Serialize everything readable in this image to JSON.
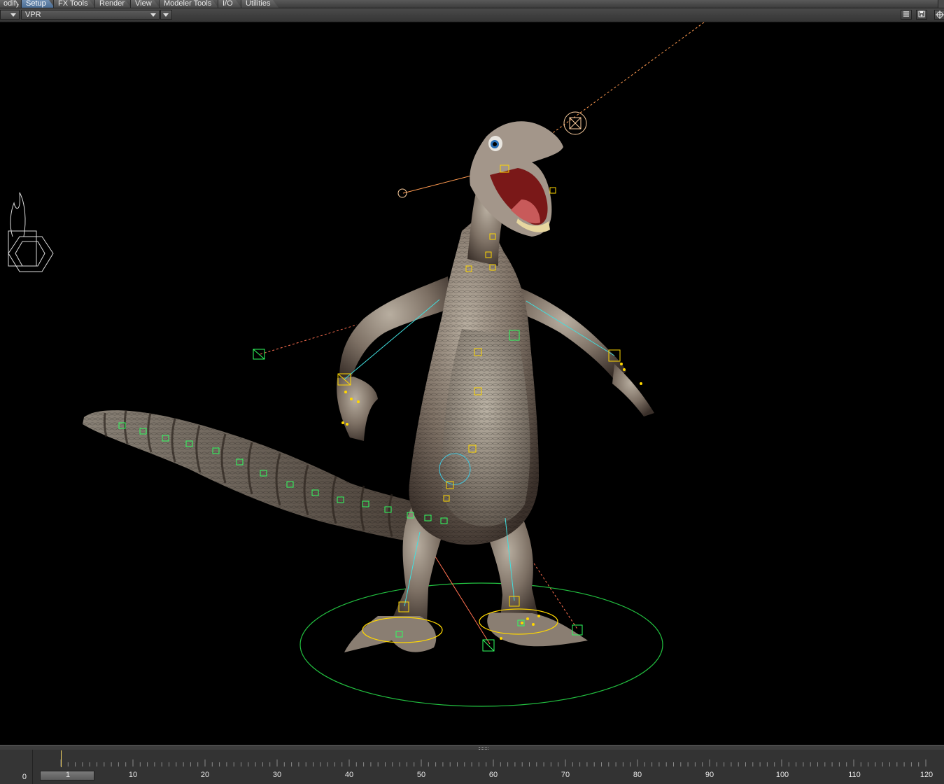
{
  "tabs": [
    {
      "label": "odify",
      "active": false
    },
    {
      "label": "Setup",
      "active": true
    },
    {
      "label": "FX Tools",
      "active": false
    },
    {
      "label": "Render",
      "active": false
    },
    {
      "label": "View",
      "active": false
    },
    {
      "label": "Modeler Tools",
      "active": false
    },
    {
      "label": "I/O",
      "active": false
    },
    {
      "label": "Utilities",
      "active": false
    }
  ],
  "viewport_header": {
    "view_mode": "VPR",
    "right_icons": [
      "list-icon",
      "save-icon",
      "move-view-icon"
    ]
  },
  "timeline": {
    "start_value": "0",
    "current_frame": "1",
    "tick_labels": [
      "10",
      "20",
      "30",
      "40",
      "50",
      "60",
      "70",
      "80",
      "90",
      "100",
      "110",
      "120"
    ]
  },
  "colors": {
    "accent_tab": "#5b7ea6",
    "bone_cyan": "#40e0e0",
    "null_green": "#30ff60",
    "handle_yellow": "#ffd700",
    "dashed_orange": "#ff9040"
  }
}
